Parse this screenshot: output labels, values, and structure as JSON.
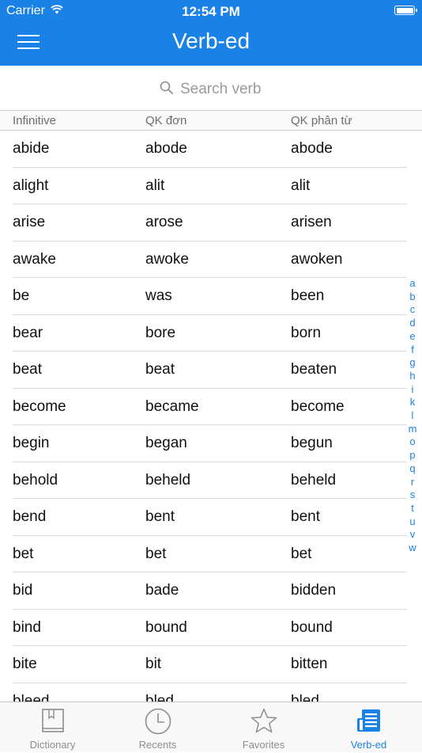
{
  "status": {
    "carrier": "Carrier",
    "time": "12:54 PM"
  },
  "header": {
    "title": "Verb-ed"
  },
  "search": {
    "placeholder": "Search verb"
  },
  "columns": [
    "Infinitive",
    "QK đơn",
    "QK phân từ"
  ],
  "rows": [
    [
      "abide",
      "abode",
      "abode"
    ],
    [
      "alight",
      "alit",
      "alit"
    ],
    [
      "arise",
      "arose",
      "arisen"
    ],
    [
      "awake",
      "awoke",
      "awoken"
    ],
    [
      "be",
      "was",
      "been"
    ],
    [
      "bear",
      "bore",
      "born"
    ],
    [
      "beat",
      "beat",
      "beaten"
    ],
    [
      "become",
      "became",
      "become"
    ],
    [
      "begin",
      "began",
      "begun"
    ],
    [
      "behold",
      "beheld",
      "beheld"
    ],
    [
      "bend",
      "bent",
      "bent"
    ],
    [
      "bet",
      "bet",
      "bet"
    ],
    [
      "bid",
      "bade",
      "bidden"
    ],
    [
      "bind",
      "bound",
      "bound"
    ],
    [
      "bite",
      "bit",
      "bitten"
    ],
    [
      "bleed",
      "bled",
      "bled"
    ]
  ],
  "index": [
    "a",
    "b",
    "c",
    "d",
    "e",
    "f",
    "g",
    "h",
    "i",
    "k",
    "l",
    "m",
    "o",
    "p",
    "q",
    "r",
    "s",
    "t",
    "u",
    "v",
    "w"
  ],
  "tabs": [
    {
      "label": "Dictionary",
      "icon": "book-icon"
    },
    {
      "label": "Recents",
      "icon": "clock-icon"
    },
    {
      "label": "Favorites",
      "icon": "star-icon"
    },
    {
      "label": "Verb-ed",
      "icon": "document-list-icon",
      "active": true
    }
  ],
  "colors": {
    "accent": "#1a82e6",
    "inactive": "#8e8e8e"
  }
}
